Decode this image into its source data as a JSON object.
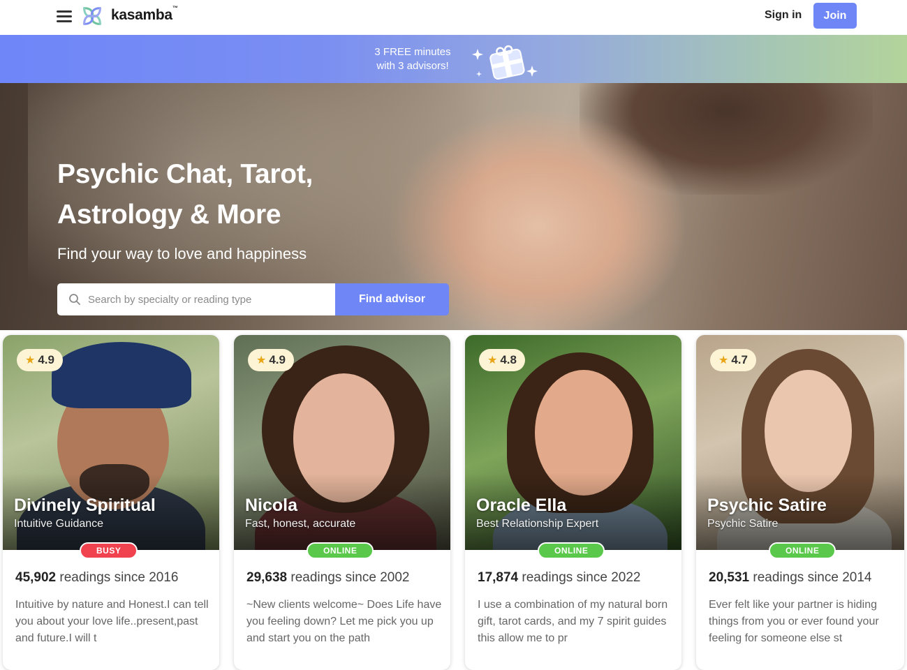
{
  "header": {
    "logo_text": "kasamba",
    "logo_tm": "™",
    "signin_label": "Sign in",
    "join_label": "Join"
  },
  "promo": {
    "line1": "3 FREE minutes",
    "line2": "with 3 advisors!"
  },
  "hero": {
    "title_line1": "Psychic Chat, Tarot,",
    "title_line2": "Astrology & More",
    "subtitle": "Find your way to love and happiness",
    "search_placeholder": "Search by specialty or reading type",
    "search_value": "",
    "find_button": "Find advisor"
  },
  "advisors": [
    {
      "rating": "4.9",
      "name": "Divinely Spiritual",
      "tagline": "Intuitive Guidance",
      "status": "BUSY",
      "readings_count": "45,902",
      "readings_suffix": "readings since 2016",
      "bio": "Intuitive by nature and Honest.I can tell you about your love life..present,past and future.I will t"
    },
    {
      "rating": "4.9",
      "name": "Nicola",
      "tagline": "Fast, honest, accurate",
      "status": "ONLINE",
      "readings_count": "29,638",
      "readings_suffix": "readings since 2002",
      "bio": "~New clients welcome~ Does Life have you feeling down? Let me pick you up and start you on the path"
    },
    {
      "rating": "4.8",
      "name": "Oracle Ella",
      "tagline": "Best Relationship Expert",
      "status": "ONLINE",
      "readings_count": "17,874",
      "readings_suffix": "readings since 2022",
      "bio": "I use a combination of my natural born gift, tarot cards, and my 7 spirit guides this allow me to pr"
    },
    {
      "rating": "4.7",
      "name": "Psychic Satire",
      "tagline": "Psychic Satire",
      "status": "ONLINE",
      "readings_count": "20,531",
      "readings_suffix": "readings since 2014",
      "bio": "Ever felt like your partner is hiding things from you or ever found your feeling for someone else st"
    }
  ],
  "colors": {
    "accent": "#6f86f6",
    "busy": "#f0424f",
    "online": "#5ac84a",
    "rating_bg": "#fdf4d6",
    "star": "#e8a515"
  },
  "icons": {
    "menu": "hamburger-menu-icon",
    "logo": "kasamba-logo-icon",
    "search": "search-icon",
    "gift": "gift-box-icon",
    "star": "star-icon"
  }
}
